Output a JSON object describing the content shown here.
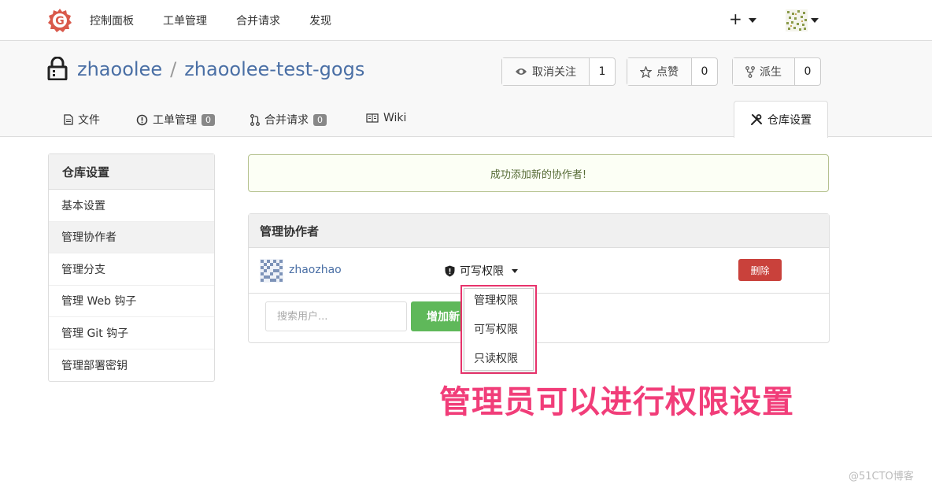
{
  "topnav": {
    "items": [
      "控制面板",
      "工单管理",
      "合并请求",
      "发现"
    ],
    "plus_label": "+"
  },
  "repo": {
    "owner": "zhaoolee",
    "separator": "/",
    "name": "zhaoolee-test-gogs",
    "watch": {
      "label": "取消关注",
      "count": "1"
    },
    "star": {
      "label": "点赞",
      "count": "0"
    },
    "fork": {
      "label": "派生",
      "count": "0"
    }
  },
  "tabs": [
    {
      "label": "文件",
      "icon": "file-icon"
    },
    {
      "label": "工单管理",
      "badge": "0",
      "icon": "issue-icon"
    },
    {
      "label": "合并请求",
      "badge": "0",
      "icon": "pull-request-icon"
    },
    {
      "label": "Wiki",
      "icon": "book-icon"
    }
  ],
  "active_tab": {
    "label": "仓库设置",
    "icon": "tools-icon"
  },
  "sidebar": {
    "title": "仓库设置",
    "items": [
      {
        "label": "基本设置"
      },
      {
        "label": "管理协作者"
      },
      {
        "label": "管理分支"
      },
      {
        "label": "管理 Web 钩子"
      },
      {
        "label": "管理 Git 钩子"
      },
      {
        "label": "管理部署密钥"
      }
    ]
  },
  "alert": {
    "message": "成功添加新的协作者!"
  },
  "collaborators": {
    "title": "管理协作者",
    "rows": [
      {
        "username": "zhaozhao",
        "permission": "可写权限",
        "delete_label": "删除"
      }
    ],
    "search_placeholder": "搜索用户...",
    "add_label": "增加新"
  },
  "permission_menu": {
    "options": [
      "管理权限",
      "可写权限",
      "只读权限"
    ]
  },
  "annotation": "管理员可以进行权限设置",
  "watermark": "@51CTO博客",
  "colors": {
    "link": "#4a6fa5",
    "danger": "#c9413b",
    "success": "#5fb85a",
    "annotation": "#f13d79",
    "highlight_border": "#e8336c"
  }
}
